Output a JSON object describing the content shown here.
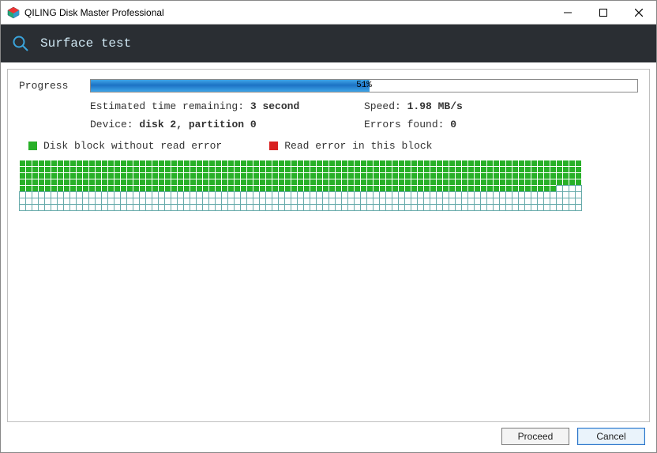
{
  "window": {
    "title": "QILING Disk Master Professional"
  },
  "header": {
    "title": "Surface test"
  },
  "progress": {
    "label": "Progress",
    "percent_text": "51%",
    "percent": 51
  },
  "info": {
    "eta_label": "Estimated time remaining: ",
    "eta_value": "3 second",
    "speed_label": "Speed: ",
    "speed_value": "1.98 MB/s",
    "device_label": "Device: ",
    "device_value": "disk 2, partition 0",
    "errors_label": "Errors found: ",
    "errors_value": "0"
  },
  "legend": {
    "ok": "Disk block without read error",
    "err": "Read error in this block"
  },
  "grid": {
    "cols": 89,
    "rows_total": 8,
    "filled_full_rows": 4,
    "partial_row_filled": 85
  },
  "buttons": {
    "proceed": "Proceed",
    "cancel": "Cancel"
  },
  "colors": {
    "block_ok": "#28b028",
    "block_err": "#d82020"
  }
}
